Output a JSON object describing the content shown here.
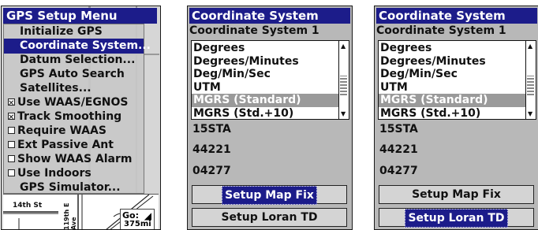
{
  "panel1": {
    "title": "GPS Setup Menu",
    "items": [
      {
        "label": "Initialize GPS",
        "check": null,
        "selected": false
      },
      {
        "label": "Coordinate System...",
        "check": null,
        "selected": true
      },
      {
        "label": "Datum Selection...",
        "check": null,
        "selected": false
      },
      {
        "label": "GPS Auto Search",
        "check": null,
        "selected": false
      },
      {
        "label": "Satellites...",
        "check": null,
        "selected": false
      },
      {
        "label": "Use WAAS/EGNOS",
        "check": true,
        "selected": false
      },
      {
        "label": "Track Smoothing",
        "check": true,
        "selected": false
      },
      {
        "label": "Require WAAS",
        "check": false,
        "selected": false
      },
      {
        "label": "Ext Passive Ant",
        "check": false,
        "selected": false
      },
      {
        "label": "Show WAAS Alarm",
        "check": false,
        "selected": false
      },
      {
        "label": "Use Indoors",
        "check": false,
        "selected": false
      },
      {
        "label": "GPS Simulator...",
        "check": null,
        "selected": false
      }
    ],
    "map": {
      "street1": "14th St",
      "street2": "119th E Ave",
      "goto_label": "Go:",
      "distance": "375mi"
    }
  },
  "panel2": {
    "title": "Coordinate System",
    "subtitle": "Coordinate System 1",
    "options": [
      "Degrees",
      "Degrees/Minutes",
      "Deg/Min/Sec",
      "UTM",
      "MGRS (Standard)",
      "MGRS (Std.+10)"
    ],
    "selected_option": "MGRS (Standard)",
    "coords": [
      "15STA",
      "44221",
      "04277"
    ],
    "buttons": {
      "map_fix": "Setup Map Fix",
      "loran": "Setup Loran TD"
    },
    "highlighted_button": "map_fix"
  },
  "panel3": {
    "title": "Coordinate System",
    "subtitle": "Coordinate System 1",
    "options": [
      "Degrees",
      "Degrees/Minutes",
      "Deg/Min/Sec",
      "UTM",
      "MGRS (Standard)",
      "MGRS (Std.+10)"
    ],
    "selected_option": "MGRS (Standard)",
    "coords": [
      "15STA",
      "44221",
      "04277"
    ],
    "buttons": {
      "map_fix": "Setup Map Fix",
      "loran": "Setup Loran TD"
    },
    "highlighted_button": "loran"
  },
  "colors": {
    "title_bar": "#1c1c8a",
    "selection": "#1c1c8a",
    "list_selection": "#9a9a9a"
  }
}
